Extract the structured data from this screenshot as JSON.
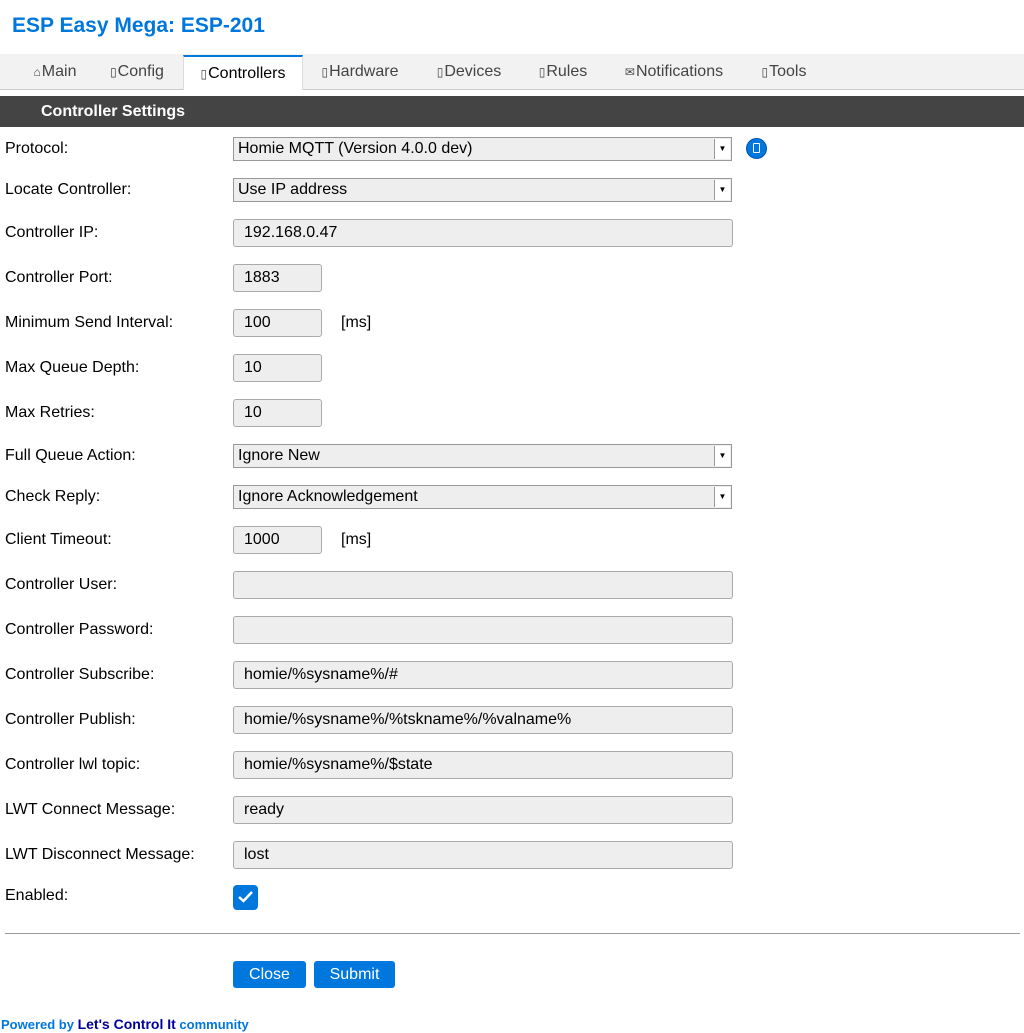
{
  "header": {
    "title": "ESP Easy Mega: ESP-201"
  },
  "tabs": [
    {
      "icon": "⌂",
      "label": "Main"
    },
    {
      "icon": "▯",
      "label": "Config"
    },
    {
      "icon": "▯",
      "label": "Controllers"
    },
    {
      "icon": "▯",
      "label": "Hardware"
    },
    {
      "icon": "▯",
      "label": "Devices"
    },
    {
      "icon": "▯",
      "label": "Rules"
    },
    {
      "icon": "✉",
      "label": "Notifications"
    },
    {
      "icon": "▯",
      "label": "Tools"
    }
  ],
  "section": {
    "title": "Controller Settings"
  },
  "form": {
    "protocol": {
      "label": "Protocol:",
      "value": "Homie MQTT (Version 4.0.0 dev)"
    },
    "locate": {
      "label": "Locate Controller:",
      "value": "Use IP address"
    },
    "ip": {
      "label": "Controller IP:",
      "value": "192.168.0.47"
    },
    "port": {
      "label": "Controller Port:",
      "value": "1883"
    },
    "min_interval": {
      "label": "Minimum Send Interval:",
      "value": "100",
      "unit": "[ms]"
    },
    "queue_depth": {
      "label": "Max Queue Depth:",
      "value": "10"
    },
    "retries": {
      "label": "Max Retries:",
      "value": "10"
    },
    "full_queue": {
      "label": "Full Queue Action:",
      "value": "Ignore New"
    },
    "check_reply": {
      "label": "Check Reply:",
      "value": "Ignore Acknowledgement"
    },
    "timeout": {
      "label": "Client Timeout:",
      "value": "1000",
      "unit": "[ms]"
    },
    "user": {
      "label": "Controller User:",
      "value": ""
    },
    "password": {
      "label": "Controller Password:",
      "value": ""
    },
    "subscribe": {
      "label": "Controller Subscribe:",
      "value": "homie/%sysname%/#"
    },
    "publish": {
      "label": "Controller Publish:",
      "value": "homie/%sysname%/%tskname%/%valname%"
    },
    "lwl": {
      "label": "Controller lwl topic:",
      "value": "homie/%sysname%/$state"
    },
    "lwt_connect": {
      "label": "LWT Connect Message:",
      "value": "ready"
    },
    "lwt_disconnect": {
      "label": "LWT Disconnect Message:",
      "value": "lost"
    },
    "enabled": {
      "label": "Enabled:"
    }
  },
  "buttons": {
    "close": "Close",
    "submit": "Submit"
  },
  "footer": {
    "prefix": "Powered by ",
    "link": "Let's Control It",
    "suffix": " community"
  },
  "colors": {
    "accent": "#0077dd",
    "section_bg": "#444444"
  }
}
